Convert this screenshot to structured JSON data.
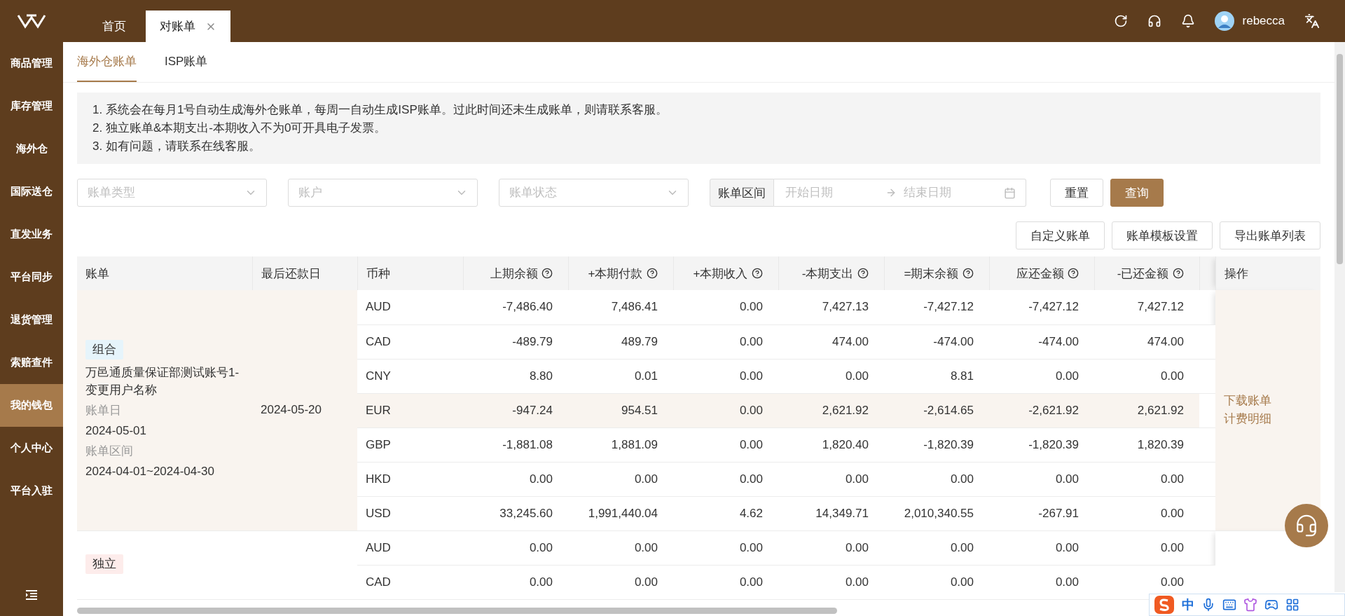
{
  "top_bar": {
    "tabs": [
      {
        "label": "首页",
        "selected": false,
        "closable": false
      },
      {
        "label": "对账单",
        "selected": true,
        "closable": true
      }
    ],
    "user": "rebecca"
  },
  "sidebar": {
    "items": [
      {
        "label": "商品管理",
        "selected": false
      },
      {
        "label": "库存管理",
        "selected": false
      },
      {
        "label": "海外仓",
        "selected": false
      },
      {
        "label": "国际送仓",
        "selected": false
      },
      {
        "label": "直发业务",
        "selected": false
      },
      {
        "label": "平台同步",
        "selected": false
      },
      {
        "label": "退货管理",
        "selected": false
      },
      {
        "label": "索赔查件",
        "selected": false
      },
      {
        "label": "我的钱包",
        "selected": true
      },
      {
        "label": "个人中心",
        "selected": false
      },
      {
        "label": "平台入驻",
        "selected": false
      }
    ]
  },
  "sub_tabs": [
    {
      "label": "海外仓账单",
      "selected": true
    },
    {
      "label": "ISP账单",
      "selected": false
    }
  ],
  "notice": [
    "1. 系统会在每月1号自动生成海外仓账单，每周一自动生成ISP账单。过此时间还未生成账单，则请联系客服。",
    "2. 独立账单&本期支出-本期收入不为0可开具电子发票。",
    "3. 如有问题，请联系在线客服。"
  ],
  "filters": {
    "selects": [
      {
        "placeholder": "账单类型"
      },
      {
        "placeholder": "账户"
      },
      {
        "placeholder": "账单状态"
      }
    ],
    "date_range": {
      "label": "账单区间",
      "start_placeholder": "开始日期",
      "end_placeholder": "结束日期"
    },
    "buttons": [
      {
        "label": "重置",
        "kind": "default"
      },
      {
        "label": "查询",
        "kind": "primary"
      }
    ]
  },
  "actions": [
    "自定义账单",
    "账单模板设置",
    "导出账单列表"
  ],
  "table": {
    "columns": [
      {
        "label": "账单",
        "help": false
      },
      {
        "label": "最后还款日",
        "help": false
      },
      {
        "label": "币种",
        "help": false
      },
      {
        "label": "上期余额",
        "help": true
      },
      {
        "label": "+本期付款",
        "help": true
      },
      {
        "label": "+本期收入",
        "help": true
      },
      {
        "label": "-本期支出",
        "help": true
      },
      {
        "label": "=期末余额",
        "help": true
      },
      {
        "label": "应还金额",
        "help": true
      },
      {
        "label": "-已还金额",
        "help": true
      }
    ],
    "action_column": "操作",
    "groups": [
      {
        "tag": {
          "label": "组合",
          "color": "#e6f4fb"
        },
        "name": "万邑通质量保证部测试账号1-变更用户名称",
        "bill_date_label": "账单日",
        "bill_date": "2024-05-01",
        "period_label": "账单区间",
        "period": "2024-04-01~2024-04-30",
        "due_date": "2024-05-20",
        "highlighted": true,
        "links": [
          "下载账单",
          "计费明细"
        ],
        "rows": [
          {
            "currency": "AUD",
            "values": [
              "-7,486.40",
              "7,486.41",
              "0.00",
              "7,427.13",
              "-7,427.12",
              "-7,427.12",
              "7,427.12"
            ],
            "highlighted": false
          },
          {
            "currency": "CAD",
            "values": [
              "-489.79",
              "489.79",
              "0.00",
              "474.00",
              "-474.00",
              "-474.00",
              "474.00"
            ],
            "highlighted": false
          },
          {
            "currency": "CNY",
            "values": [
              "8.80",
              "0.01",
              "0.00",
              "0.00",
              "8.81",
              "0.00",
              "0.00"
            ],
            "highlighted": false
          },
          {
            "currency": "EUR",
            "values": [
              "-947.24",
              "954.51",
              "0.00",
              "2,621.92",
              "-2,614.65",
              "-2,621.92",
              "2,621.92"
            ],
            "highlighted": true
          },
          {
            "currency": "GBP",
            "values": [
              "-1,881.08",
              "1,881.09",
              "0.00",
              "1,820.40",
              "-1,820.39",
              "-1,820.39",
              "1,820.39"
            ],
            "highlighted": false
          },
          {
            "currency": "HKD",
            "values": [
              "0.00",
              "0.00",
              "0.00",
              "0.00",
              "0.00",
              "0.00",
              "0.00"
            ],
            "highlighted": false
          },
          {
            "currency": "USD",
            "values": [
              "33,245.60",
              "1,991,440.04",
              "4.62",
              "14,349.71",
              "2,010,340.55",
              "-267.91",
              "0.00"
            ],
            "highlighted": false
          }
        ]
      },
      {
        "tag": {
          "label": "独立",
          "color": "#fdeceb"
        },
        "highlighted": false,
        "rows": [
          {
            "currency": "AUD",
            "values": [
              "0.00",
              "0.00",
              "0.00",
              "0.00",
              "0.00",
              "0.00",
              "0.00"
            ],
            "highlighted": false
          },
          {
            "currency": "CAD",
            "values": [
              "0.00",
              "0.00",
              "0.00",
              "0.00",
              "0.00",
              "0.00",
              "0.00"
            ],
            "highlighted": false
          }
        ]
      }
    ]
  },
  "ime": {
    "label": "中"
  }
}
